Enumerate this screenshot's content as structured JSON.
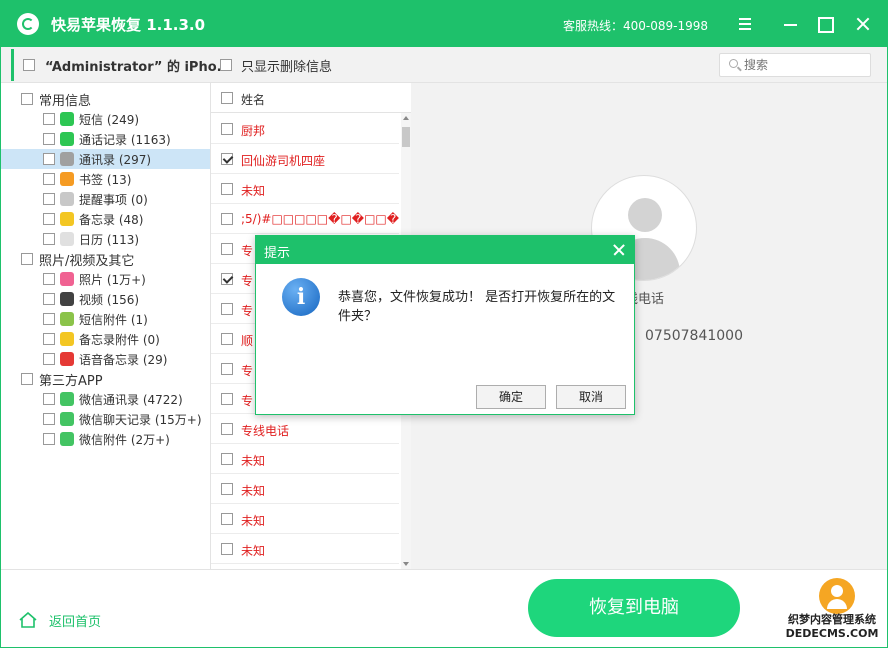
{
  "app": {
    "title": "快易苹果恢复 1.1.3.0",
    "hotline": "客服热线：400-089-1998",
    "accent_color": "#1ec16b"
  },
  "toolbar": {
    "device_label": "“Administrator” 的 iPho...",
    "show_deleted_label": "只显示删除信息",
    "search_placeholder": "搜索"
  },
  "tree": {
    "categories": [
      {
        "label": "常用信息",
        "items": [
          {
            "label": "短信 (249)",
            "icon": "message-icon",
            "color": "#2dc653"
          },
          {
            "label": "通话记录 (1163)",
            "icon": "phone-icon",
            "color": "#2dc653"
          },
          {
            "label": "通讯录 (297)",
            "icon": "contacts-icon",
            "color": "#a0a0a0",
            "selected": true
          },
          {
            "label": "书签 (13)",
            "icon": "book-icon",
            "color": "#f59b23"
          },
          {
            "label": "提醒事项 (0)",
            "icon": "reminder-icon",
            "color": "#c8c8c8"
          },
          {
            "label": "备忘录 (48)",
            "icon": "notes-icon",
            "color": "#f3c623"
          },
          {
            "label": "日历 (113)",
            "icon": "calendar-icon",
            "color": "#e0e0e0"
          }
        ]
      },
      {
        "label": "照片/视频及其它",
        "items": [
          {
            "label": "照片 (1万+)",
            "icon": "photos-icon",
            "color": "#f06292"
          },
          {
            "label": "视频 (156)",
            "icon": "video-icon",
            "color": "#424242"
          },
          {
            "label": "短信附件 (1)",
            "icon": "attachment-icon",
            "color": "#8bc34a"
          },
          {
            "label": "备忘录附件 (0)",
            "icon": "notes-attachment-icon",
            "color": "#f3c623"
          },
          {
            "label": "语音备忘录 (29)",
            "icon": "voice-memo-icon",
            "color": "#e53935"
          }
        ]
      },
      {
        "label": "第三方APP",
        "items": [
          {
            "label": "微信通讯录 (4722)",
            "icon": "wechat-contacts-icon",
            "color": "#43c463"
          },
          {
            "label": "微信聊天记录 (15万+)",
            "icon": "wechat-chat-icon",
            "color": "#43c463"
          },
          {
            "label": "微信附件 (2万+)",
            "icon": "wechat-attachment-icon",
            "color": "#43c463"
          }
        ]
      }
    ]
  },
  "list": {
    "header": "姓名",
    "rows": [
      {
        "name": "厨邦",
        "checked": false
      },
      {
        "name": "回仙游司机四座",
        "checked": true
      },
      {
        "name": "未知",
        "checked": false
      },
      {
        "name": ";5/)#□□□□□�□�□□�□�",
        "checked": false
      },
      {
        "name": "专",
        "checked": false
      },
      {
        "name": "专",
        "checked": true
      },
      {
        "name": "专",
        "checked": false
      },
      {
        "name": "顺",
        "checked": false
      },
      {
        "name": "专",
        "checked": false
      },
      {
        "name": "专",
        "checked": false
      },
      {
        "name": "专线电话",
        "checked": false
      },
      {
        "name": "未知",
        "checked": false
      },
      {
        "name": "未知",
        "checked": false
      },
      {
        "name": "未知",
        "checked": false
      },
      {
        "name": "未知",
        "checked": false
      }
    ]
  },
  "detail": {
    "name": "线电话",
    "phone": "07507841000"
  },
  "bottom": {
    "home_label": "返回首页",
    "recover_label": "恢复到电脑",
    "watermark": "织梦内容管理系统 DEDECMS.COM"
  },
  "dialog": {
    "title": "提示",
    "message": "恭喜您，文件恢复成功！ 是否打开恢复所在的文件夹？",
    "ok_label": "确定",
    "cancel_label": "取消"
  }
}
